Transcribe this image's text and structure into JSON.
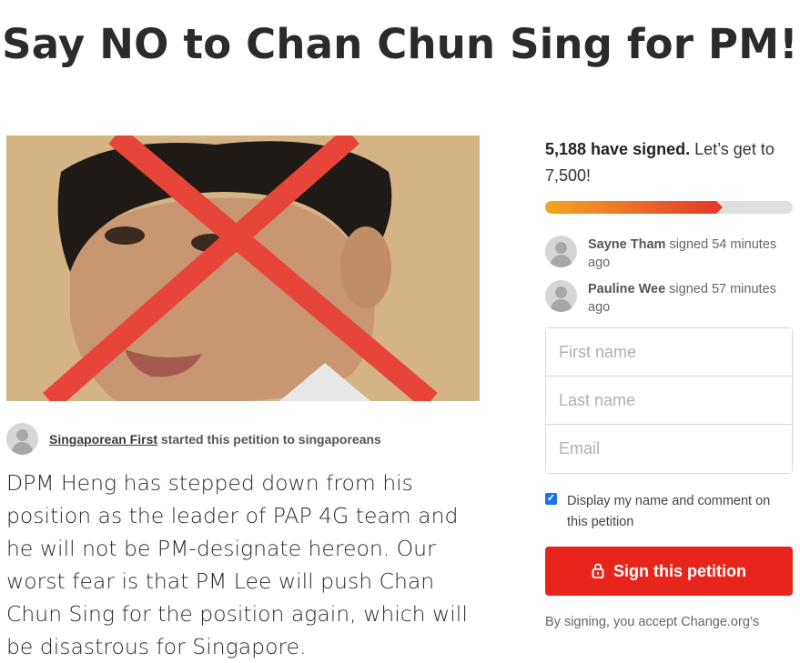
{
  "page": {
    "title": "Say NO to Chan Chun Sing for PM!"
  },
  "starter": {
    "name": "Singaporean First",
    "action_text": " started this petition to singaporeans"
  },
  "description": "DPM Heng has stepped down from his position as the leader of PAP 4G team and he will not be PM-designate hereon. Our worst fear is that PM Lee will push Chan Chun Sing for the position again, which will be disastrous for Singapore.",
  "progress": {
    "signed_count_text": "5,188 have signed.",
    "goal_text": " Let’s get to 7,500!",
    "signed": 5188,
    "goal": 7500,
    "fill_color_start": "#f5a623",
    "fill_color_end": "#e33a2a"
  },
  "recent_signers": [
    {
      "name": "Sayne Tham",
      "action": " signed 54 minutes ago"
    },
    {
      "name": "Pauline Wee",
      "action": " signed 57 minutes ago"
    }
  ],
  "form": {
    "first_name_placeholder": "First name",
    "last_name_placeholder": "Last name",
    "email_placeholder": "Email",
    "display_checkbox_label": "Display my name and comment on this petition",
    "display_checkbox_checked": true
  },
  "sign_button": {
    "label": "Sign this petition",
    "icon": "lock-icon",
    "color": "#e8251c"
  },
  "terms_text": "By signing, you accept Change.org’s",
  "image": {
    "cross_color": "#e8453a"
  }
}
